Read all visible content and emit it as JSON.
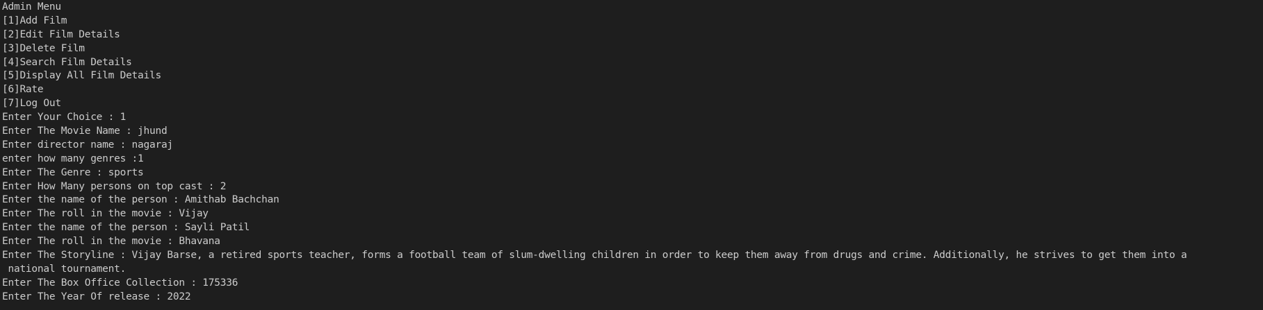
{
  "terminal": {
    "lines": [
      "Admin Menu",
      "[1]Add Film",
      "[2]Edit Film Details",
      "[3]Delete Film",
      "[4]Search Film Details",
      "[5]Display All Film Details",
      "[6]Rate",
      "[7]Log Out",
      "Enter Your Choice : 1",
      "Enter The Movie Name : jhund",
      "Enter director name : nagaraj",
      "enter how many genres :1",
      "Enter The Genre : sports",
      "Enter How Many persons on top cast : 2",
      "Enter the name of the person : Amithab Bachchan",
      "Enter The roll in the movie : Vijay",
      "Enter the name of the person : Sayli Patil",
      "Enter The roll in the movie : Bhavana",
      "Enter The Storyline : Vijay Barse, a retired sports teacher, forms a football team of slum-dwelling children in order to keep them away from drugs and crime. Additionally, he strives to get them into a",
      " national tournament.",
      "Enter The Box Office Collection : 175336",
      "Enter The Year Of release : 2022"
    ]
  }
}
